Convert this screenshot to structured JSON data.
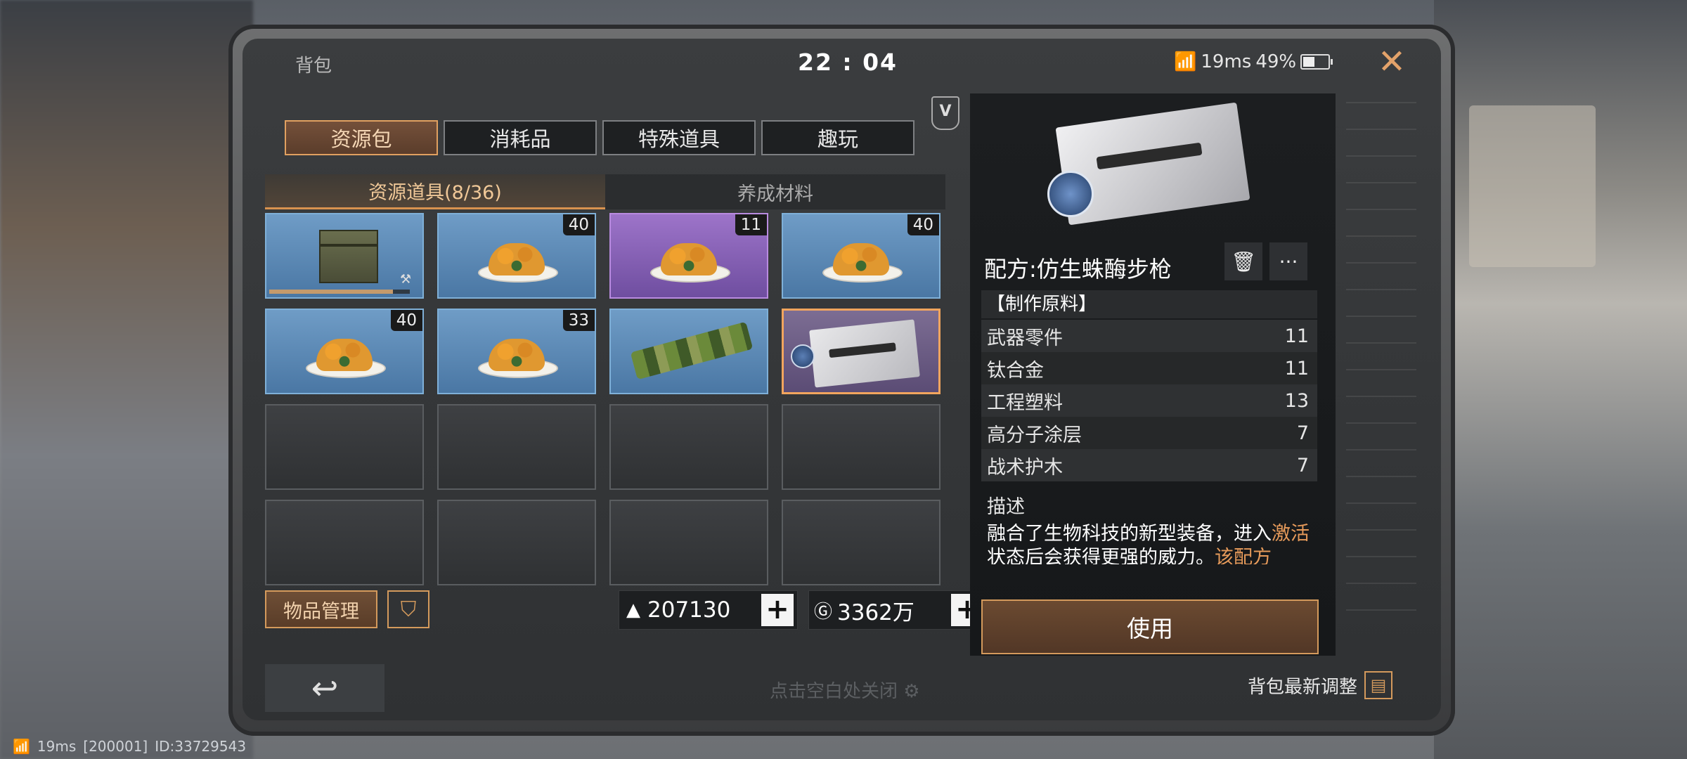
{
  "header": {
    "title": "背包",
    "time": "22 : 04",
    "ping": "19ms",
    "battery": "49%"
  },
  "badge_letter": "V",
  "tabs": [
    "资源包",
    "消耗品",
    "特殊道具",
    "趣玩"
  ],
  "subtabs": [
    "资源道具(8/36)",
    "养成材料"
  ],
  "grid": {
    "items": [
      {
        "type": "crate",
        "rarity": "blue",
        "count": "",
        "progress": 0.88
      },
      {
        "type": "food",
        "rarity": "blue",
        "count": "40"
      },
      {
        "type": "food",
        "rarity": "purple",
        "count": "11"
      },
      {
        "type": "food",
        "rarity": "blue",
        "count": "40"
      },
      {
        "type": "food",
        "rarity": "blue",
        "count": "40"
      },
      {
        "type": "food",
        "rarity": "blue",
        "count": "33"
      },
      {
        "type": "camo",
        "rarity": "blue",
        "count": ""
      },
      {
        "type": "blueprint",
        "rarity": "selected",
        "count": ""
      }
    ],
    "empty_slots": 8
  },
  "bottom": {
    "manage_label": "物品管理",
    "filter_icon": "funnel-icon",
    "currency1_value": "207130",
    "currency2_value": "3362万",
    "close_hint": "点击空白处关闭",
    "latest_label": "背包最新调整",
    "back_icon": "back-arrow-icon"
  },
  "detail": {
    "title": "配方:仿生蛛酶步枪",
    "materials_heading": "【制作原料】",
    "materials": [
      {
        "name": "武器零件",
        "qty": "11"
      },
      {
        "name": "钛合金",
        "qty": "11"
      },
      {
        "name": "工程塑料",
        "qty": "13"
      },
      {
        "name": "高分子涂层",
        "qty": "7"
      },
      {
        "name": "战术护木",
        "qty": "7"
      }
    ],
    "desc_heading": "描述",
    "desc_part1": "融合了生物科技的新型装备，进入",
    "desc_hl1": "激活",
    "desc_part2": "状态后会获得更强的威力。",
    "desc_hl2": "该配方",
    "use_label": "使用"
  },
  "footer": {
    "ping": "19ms",
    "server": "[200001]",
    "id": "ID:33729543"
  },
  "colors": {
    "accent": "#d49a5c",
    "blue_rarity": "#6f9cc6",
    "purple_rarity": "#9d74c9"
  }
}
